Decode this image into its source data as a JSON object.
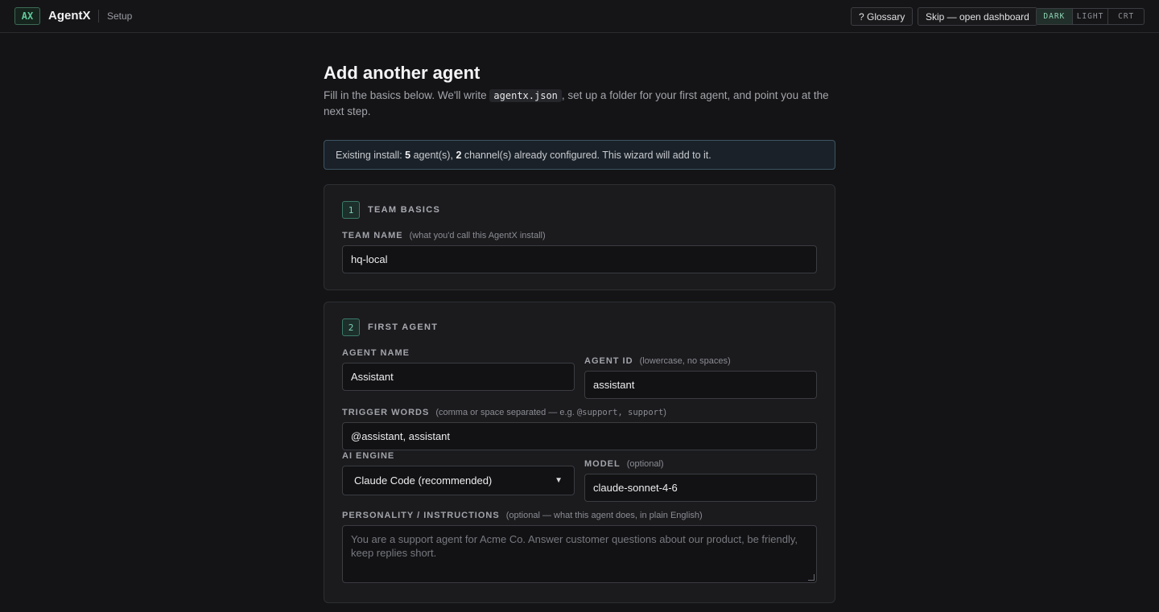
{
  "topbar": {
    "logo": "AX",
    "brand": "AgentX",
    "section": "Setup",
    "glossary_label": "? Glossary",
    "skip_label": "Skip — open dashboard",
    "themes": [
      "DARK",
      "LIGHT",
      "CRT"
    ],
    "active_theme": "DARK"
  },
  "header": {
    "title": "Add another agent",
    "lead_before": "Fill in the basics below. We'll write",
    "lead_code": "agentx.json",
    "lead_after": ", set up a folder for your first agent, and point you at the next step."
  },
  "notice": {
    "prefix": "Existing install:",
    "agents": "5",
    "agents_text": "agent(s),",
    "channels": "2",
    "channels_text": "channel(s) already configured. This wizard will add to it."
  },
  "team_basics": {
    "step": "1",
    "title": "TEAM BASICS",
    "team_name_label": "TEAM NAME",
    "team_name_hint": "(what you'd call this AgentX install)",
    "team_name_value": "hq-local"
  },
  "first_agent": {
    "step": "2",
    "title": "FIRST AGENT",
    "agent_name_label": "AGENT NAME",
    "agent_name_value": "Assistant",
    "agent_id_label": "AGENT ID",
    "agent_id_hint": "(lowercase, no spaces)",
    "agent_id_value": "assistant",
    "trigger_label": "TRIGGER WORDS",
    "trigger_hint_prefix": "(comma or space separated — e.g.",
    "trigger_hint_example": "@support, support",
    "trigger_hint_suffix": ")",
    "trigger_value": "@assistant, assistant",
    "engine_label": "AI ENGINE",
    "engine_value": "Claude Code (recommended)",
    "model_label": "MODEL",
    "model_hint": "(optional)",
    "model_value": "claude-sonnet-4-6",
    "personality_label": "PERSONALITY / INSTRUCTIONS",
    "personality_hint": "(optional — what this agent does, in plain English)",
    "personality_placeholder": "You are a support agent for Acme Co. Answer customer questions about our product, be friendly, keep replies short."
  }
}
